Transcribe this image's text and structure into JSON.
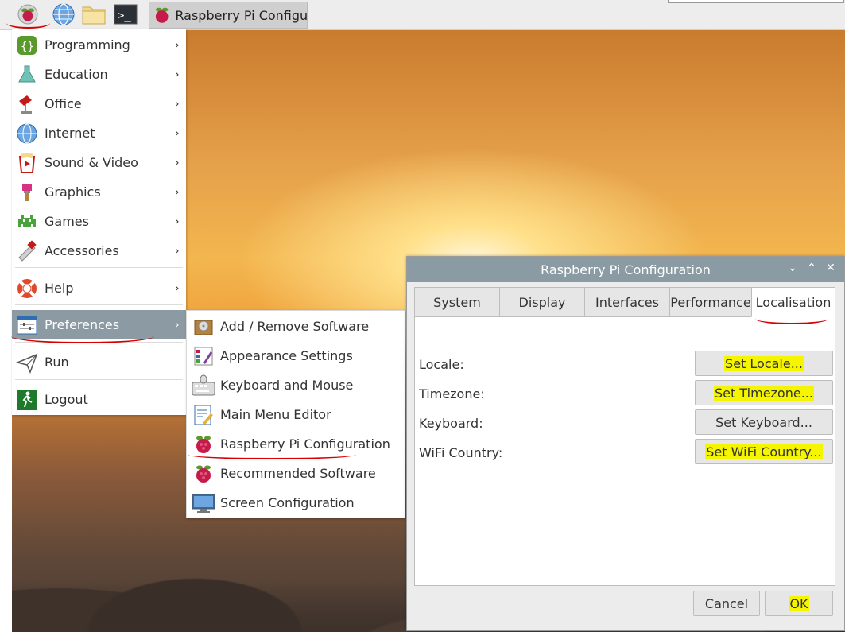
{
  "taskbar": {
    "task_title": "Raspberry Pi Configu…"
  },
  "main_menu": {
    "items": [
      {
        "label": "Programming",
        "icon": "programming-icon"
      },
      {
        "label": "Education",
        "icon": "education-icon"
      },
      {
        "label": "Office",
        "icon": "office-icon"
      },
      {
        "label": "Internet",
        "icon": "internet-icon"
      },
      {
        "label": "Sound & Video",
        "icon": "sound-video-icon"
      },
      {
        "label": "Graphics",
        "icon": "graphics-icon"
      },
      {
        "label": "Games",
        "icon": "games-icon"
      },
      {
        "label": "Accessories",
        "icon": "accessories-icon"
      },
      {
        "label": "Help",
        "icon": "help-icon"
      },
      {
        "label": "Preferences",
        "icon": "preferences-icon"
      },
      {
        "label": "Run",
        "icon": "run-icon"
      },
      {
        "label": "Logout",
        "icon": "logout-icon"
      }
    ],
    "arrow": "›"
  },
  "preferences_submenu": {
    "items": [
      {
        "label": "Add / Remove Software"
      },
      {
        "label": "Appearance Settings"
      },
      {
        "label": "Keyboard and Mouse"
      },
      {
        "label": "Main Menu Editor"
      },
      {
        "label": "Raspberry Pi Configuration"
      },
      {
        "label": "Recommended Software"
      },
      {
        "label": "Screen Configuration"
      }
    ]
  },
  "dialog": {
    "title": "Raspberry Pi Configuration",
    "tabs": [
      "System",
      "Display",
      "Interfaces",
      "Performance",
      "Localisation"
    ],
    "active_tab": "Localisation",
    "rows": [
      {
        "label": "Locale:",
        "button": "Set Locale..."
      },
      {
        "label": "Timezone:",
        "button": "Set Timezone..."
      },
      {
        "label": "Keyboard:",
        "button": "Set Keyboard..."
      },
      {
        "label": "WiFi Country:",
        "button": "Set WiFi Country..."
      }
    ],
    "cancel": "Cancel",
    "ok": "OK"
  },
  "colors": {
    "menu_selected": "#8c9aa3",
    "titlebar": "#8b9ba3",
    "highlight": "#f5f500",
    "annotation": "#d80000"
  }
}
